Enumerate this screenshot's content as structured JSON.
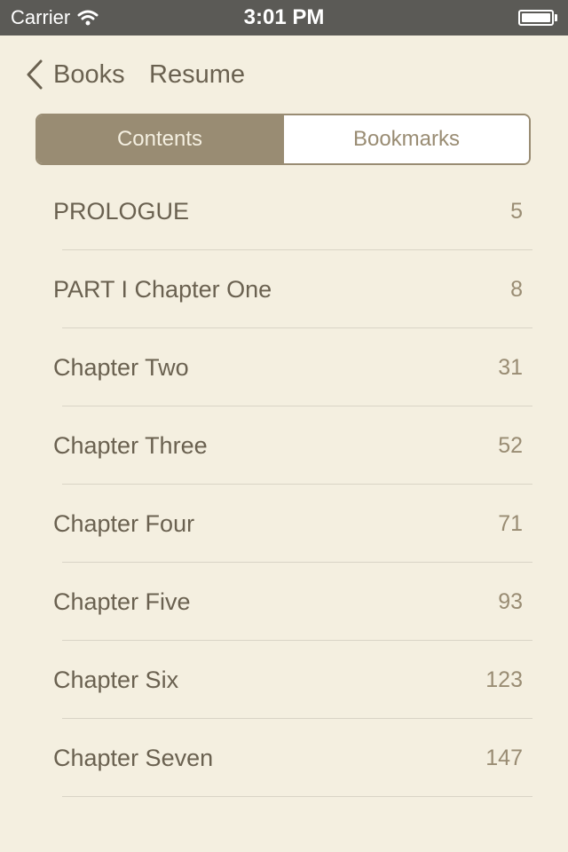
{
  "status_bar": {
    "carrier": "Carrier",
    "time": "3:01 PM",
    "battery_level": 1.0
  },
  "nav": {
    "back_label": "Books",
    "resume_label": "Resume"
  },
  "segments": [
    {
      "label": "Contents",
      "selected": true
    },
    {
      "label": "Bookmarks",
      "selected": false
    }
  ],
  "toc": [
    {
      "title": "PROLOGUE",
      "page": "5"
    },
    {
      "title": "PART I Chapter One",
      "page": "8"
    },
    {
      "title": "Chapter Two",
      "page": "31"
    },
    {
      "title": "Chapter Three",
      "page": "52"
    },
    {
      "title": "Chapter Four",
      "page": "71"
    },
    {
      "title": "Chapter Five",
      "page": "93"
    },
    {
      "title": "Chapter Six",
      "page": "123"
    },
    {
      "title": "Chapter Seven",
      "page": "147"
    }
  ],
  "colors": {
    "background": "#f4efe0",
    "accent": "#998c73",
    "text": "#6a6150",
    "status_bar": "#5b5a56"
  },
  "icons": {
    "signal": "wifi-icon",
    "battery": "battery-icon",
    "back": "chevron-left-icon"
  }
}
